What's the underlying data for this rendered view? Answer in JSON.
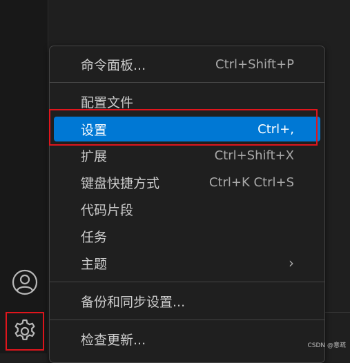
{
  "menu": {
    "items": [
      {
        "label": "命令面板...",
        "shortcut": "Ctrl+Shift+P"
      },
      {
        "label": "配置文件",
        "shortcut": ""
      },
      {
        "label": "设置",
        "shortcut": "Ctrl+,"
      },
      {
        "label": "扩展",
        "shortcut": "Ctrl+Shift+X"
      },
      {
        "label": "键盘快捷方式",
        "shortcut": "Ctrl+K Ctrl+S"
      },
      {
        "label": "代码片段",
        "shortcut": ""
      },
      {
        "label": "任务",
        "shortcut": ""
      },
      {
        "label": "主题",
        "shortcut": ""
      },
      {
        "label": "备份和同步设置...",
        "shortcut": ""
      },
      {
        "label": "检查更新...",
        "shortcut": ""
      }
    ],
    "active_index": 2,
    "submenu_indicator": "›"
  },
  "activity_bar": {
    "account_icon": "account-icon",
    "manage_icon": "gear-icon"
  },
  "watermark": "CSDN @意疏",
  "colors": {
    "highlight": "#0078d4",
    "annotation_box": "#e0151c",
    "menu_bg": "#1f1f1f",
    "activity_bar_bg": "#181818"
  }
}
